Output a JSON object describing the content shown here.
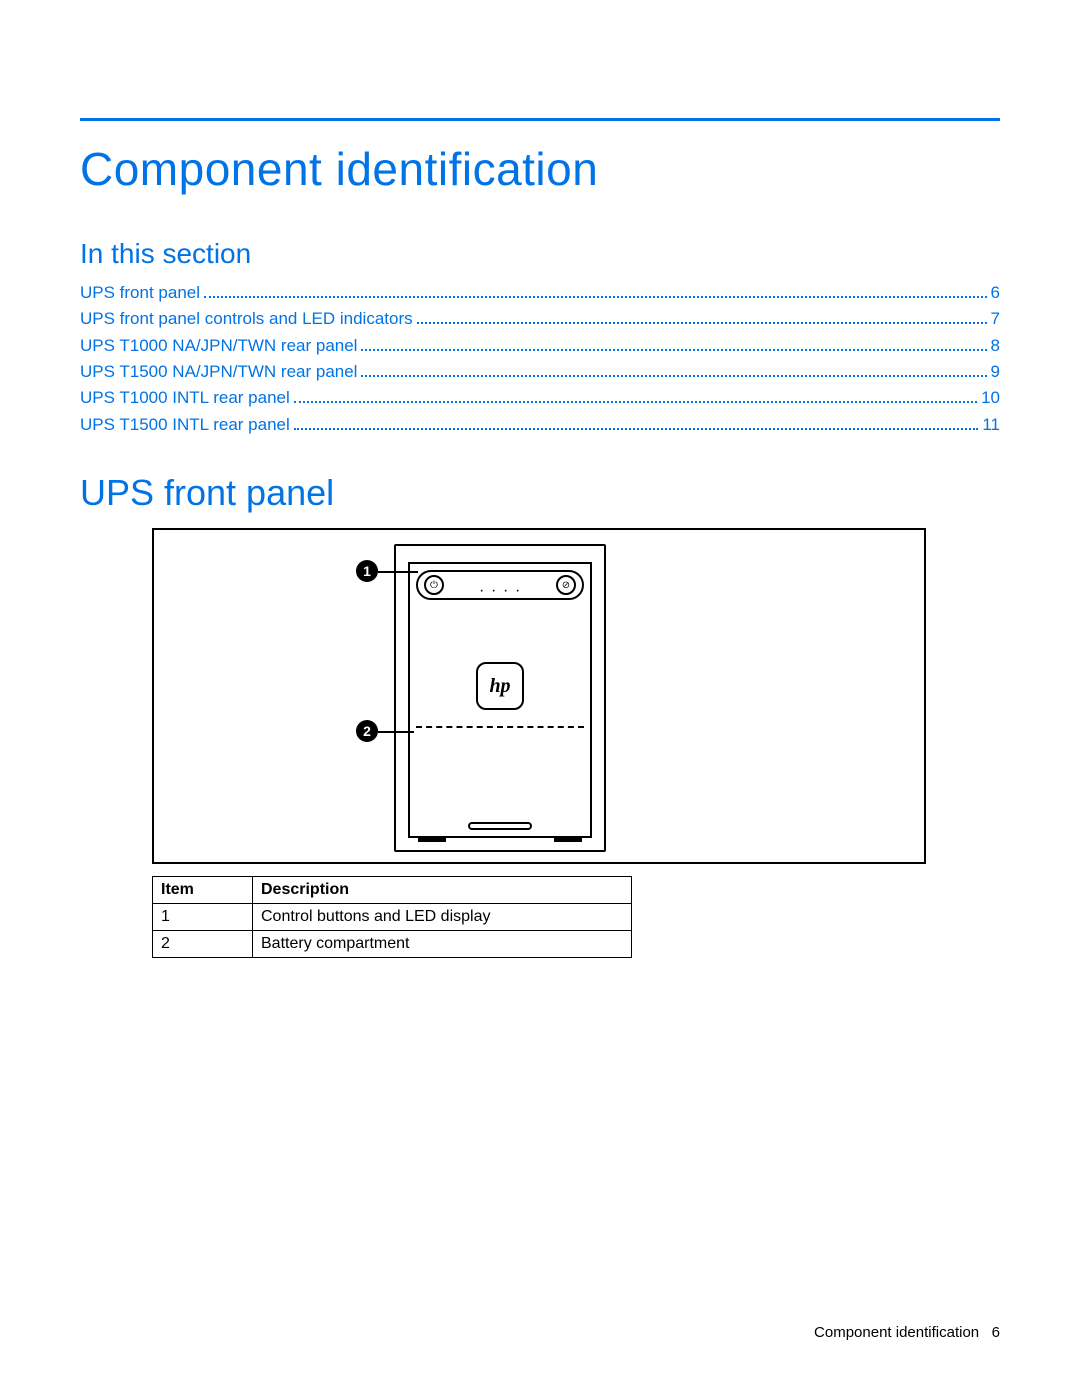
{
  "title": "Component identification",
  "subhead": "In this section",
  "toc": [
    {
      "label": "UPS front panel",
      "page": "6"
    },
    {
      "label": "UPS front panel controls and LED indicators",
      "page": "7"
    },
    {
      "label": "UPS T1000 NA/JPN/TWN rear panel",
      "page": "8"
    },
    {
      "label": "UPS T1500 NA/JPN/TWN rear panel",
      "page": "9"
    },
    {
      "label": "UPS T1000 INTL rear panel",
      "page": "10"
    },
    {
      "label": "UPS T1500 INTL rear panel",
      "page": "11"
    }
  ],
  "section_heading": "UPS front panel",
  "figure": {
    "callouts": [
      {
        "num": "1",
        "target": "control-strip"
      },
      {
        "num": "2",
        "target": "battery-compartment"
      }
    ],
    "logo_text": "hp"
  },
  "table": {
    "headers": {
      "item": "Item",
      "desc": "Description"
    },
    "rows": [
      {
        "item": "1",
        "desc": "Control buttons and LED display"
      },
      {
        "item": "2",
        "desc": "Battery compartment"
      }
    ]
  },
  "footer": {
    "section": "Component identification",
    "page": "6"
  }
}
